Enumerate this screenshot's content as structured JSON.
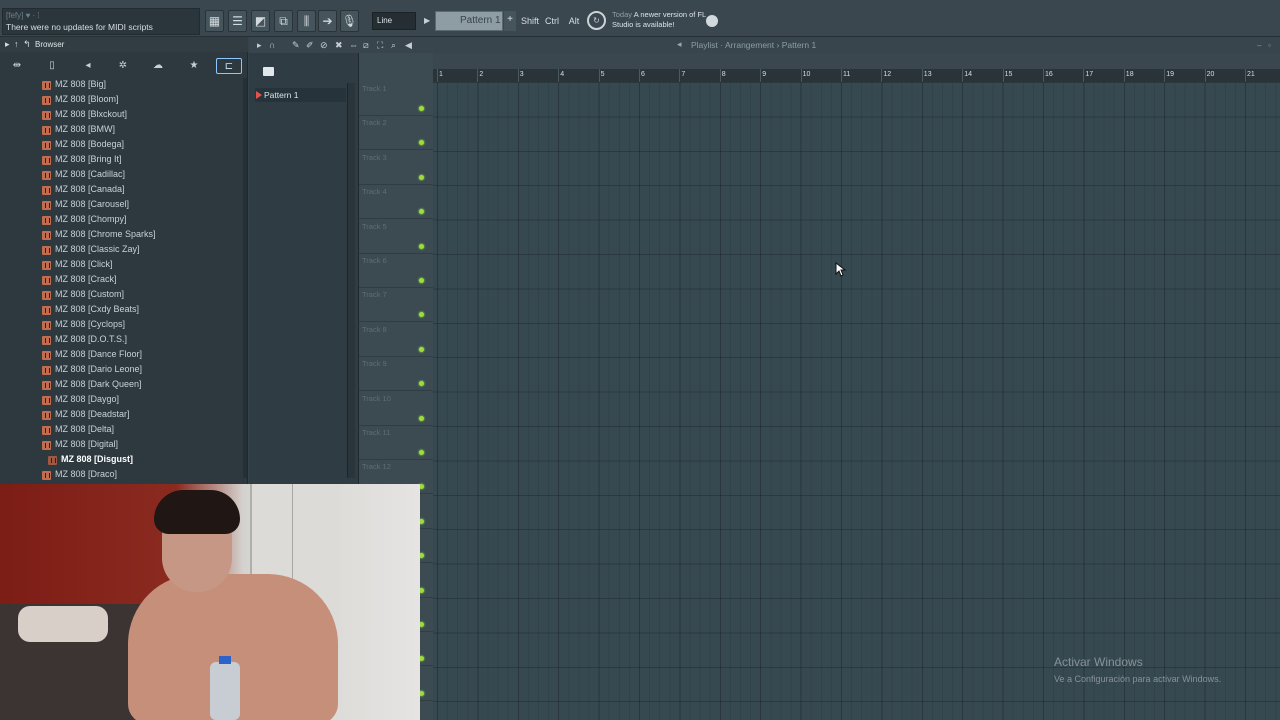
{
  "topbar": {
    "hint_title": "[fefy] ♥ · ⁞",
    "hint_text": "There were no updates for MIDI scripts",
    "snap": "Line",
    "pattern": "Pattern 1",
    "pattern_plus": "+",
    "keys": [
      "Shift",
      "Ctrl",
      "Alt"
    ],
    "news_when": "Today",
    "news_text": "A newer version of FL Studio is available!"
  },
  "browser": {
    "title": "Browser",
    "items": [
      "MZ 808 [Big]",
      "MZ 808 [Bloom]",
      "MZ 808 [Blxckout]",
      "MZ 808 [BMW]",
      "MZ 808 [Bodega]",
      "MZ 808 [Bring It]",
      "MZ 808 [Cadillac]",
      "MZ 808 [Canada]",
      "MZ 808 [Carousel]",
      "MZ 808 [Chompy]",
      "MZ 808 [Chrome Sparks]",
      "MZ 808 [Classic Zay]",
      "MZ 808 [Click]",
      "MZ 808 [Crack]",
      "MZ 808 [Custom]",
      "MZ 808 [Cxdy Beats]",
      "MZ 808 [Cyclops]",
      "MZ 808 [D.O.T.S.]",
      "MZ 808 [Dance Floor]",
      "MZ 808 [Dario Leone]",
      "MZ 808 [Dark Queen]",
      "MZ 808 [Daygo]",
      "MZ 808 [Deadstar]",
      "MZ 808 [Delta]",
      "MZ 808 [Digital]",
      "MZ 808 [Disgust]",
      "MZ 808 [Draco]"
    ],
    "selected_index": 25
  },
  "patterns": {
    "items": [
      "Pattern 1"
    ]
  },
  "playlist": {
    "title": "Playlist · Arrangement › Pattern 1",
    "ruler": [
      "1",
      "2",
      "3",
      "4",
      "5",
      "6",
      "7",
      "8",
      "9",
      "10",
      "11",
      "12",
      "13",
      "14",
      "15",
      "16",
      "17",
      "18",
      "19",
      "20",
      "21"
    ],
    "tracks": [
      "Track 1",
      "Track 2",
      "Track 3",
      "Track 4",
      "Track 5",
      "Track 6",
      "Track 7",
      "Track 8",
      "Track 9",
      "Track 10",
      "Track 11",
      "Track 12"
    ]
  },
  "watermark": {
    "title": "Activar Windows",
    "subtitle": "Ve a Configuración para activar Windows."
  },
  "colors": {
    "track_led": "#9cdd3a",
    "folder": "#c06c4e",
    "pattern_marker": "#e25252"
  }
}
